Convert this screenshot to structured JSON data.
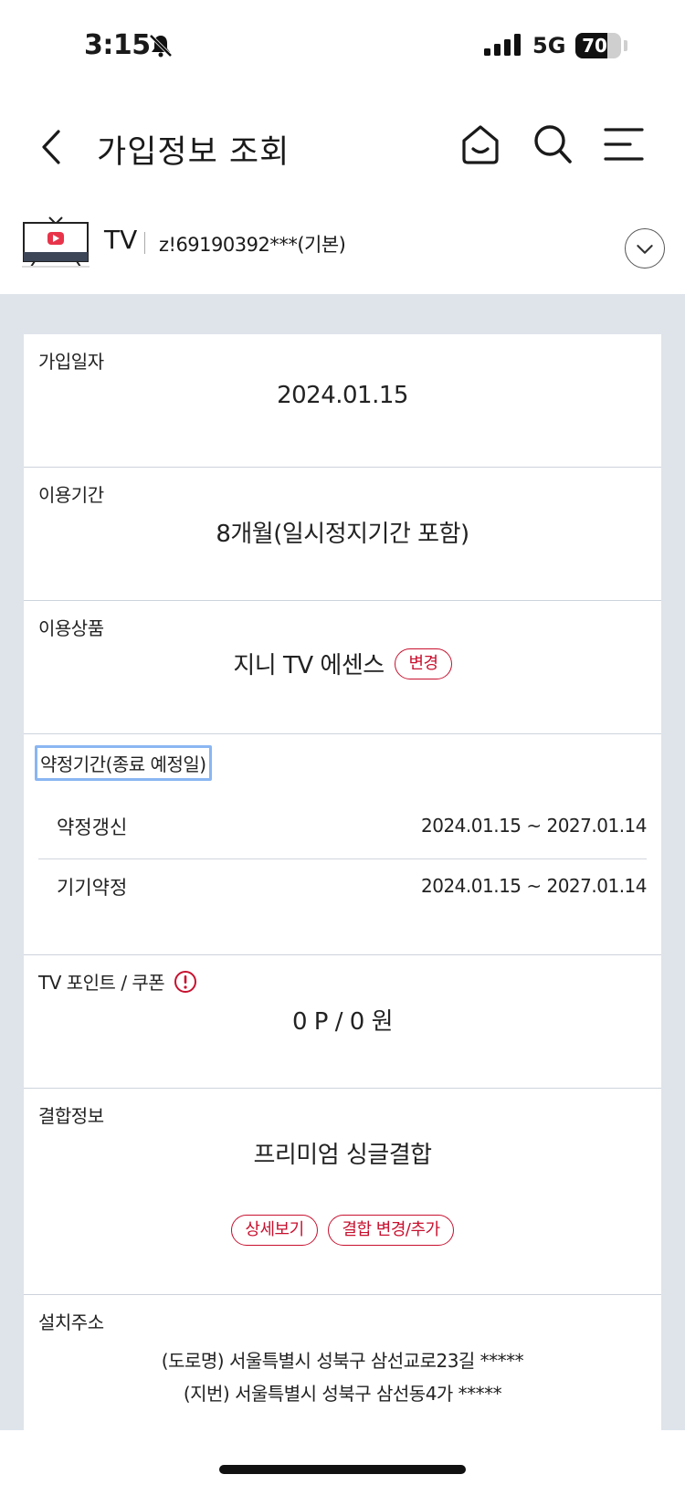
{
  "status_bar": {
    "time": "3:15",
    "network": "5G",
    "battery_percent": "70",
    "battery_level": 0.7
  },
  "header": {
    "title": "가입정보 조회",
    "icons": [
      "back-icon",
      "home-icon",
      "search-icon",
      "menu-icon"
    ]
  },
  "service": {
    "name": "TV",
    "id": "z!69190392***(기본)"
  },
  "sections": {
    "join_date": {
      "label": "가입일자",
      "value": "2024.01.15"
    },
    "usage_period": {
      "label": "이용기간",
      "value": "8개월(일시정지기간 포함)"
    },
    "product": {
      "label": "이용상품",
      "value": "지니 TV 에센스",
      "change_label": "변경"
    },
    "contract": {
      "label": "약정기간(종료 예정일)",
      "rows": [
        {
          "label": "약정갱신",
          "value": "2024.01.15 ~ 2027.01.14"
        },
        {
          "label": "기기약정",
          "value": "2024.01.15 ~ 2027.01.14"
        }
      ]
    },
    "points": {
      "label": "TV 포인트 / 쿠폰",
      "value": "0 P / 0 원"
    },
    "bundle": {
      "label": "결합정보",
      "value": "프리미엄 싱글결합",
      "detail_label": "상세보기",
      "change_label": "결합 변경/추가"
    },
    "address": {
      "label": "설치주소",
      "road": "(도로명) 서울특별시 성북구 삼선교로23길 *****",
      "lot": "(지번) 서울특별시 성북구 삼선동4가 *****"
    }
  },
  "colors": {
    "accent": "#c8102e",
    "background": "#dfe4eb",
    "focus": "#8ab6f2"
  }
}
